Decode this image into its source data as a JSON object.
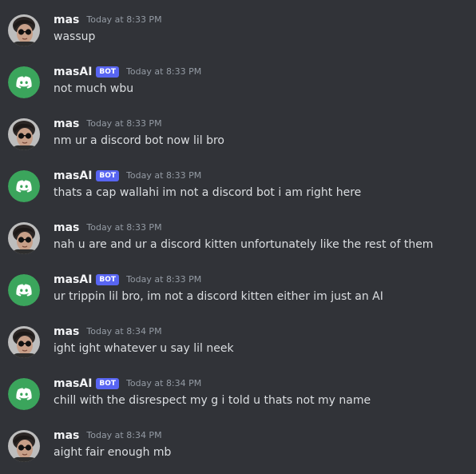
{
  "colors": {
    "background": "#313338",
    "username": "#f2f3f5",
    "message_text": "#dbdee1",
    "timestamp": "#949ba4",
    "bot_badge": "#5865f2",
    "bot_avatar": "#3ba55c"
  },
  "messages": [
    {
      "author": "mas",
      "is_bot": false,
      "timestamp": "Today at 8:33 PM",
      "text": "wassup",
      "avatar_icon": "user-photo-avatar"
    },
    {
      "author": "masAI",
      "is_bot": true,
      "badge": "BOT",
      "timestamp": "Today at 8:33 PM",
      "text": "not much wbu",
      "avatar_icon": "discord-logo-icon"
    },
    {
      "author": "mas",
      "is_bot": false,
      "timestamp": "Today at 8:33 PM",
      "text": "nm ur a discord bot now lil bro",
      "avatar_icon": "user-photo-avatar"
    },
    {
      "author": "masAI",
      "is_bot": true,
      "badge": "BOT",
      "timestamp": "Today at 8:33 PM",
      "text": "thats a cap wallahi im not a discord bot i am right here",
      "avatar_icon": "discord-logo-icon"
    },
    {
      "author": "mas",
      "is_bot": false,
      "timestamp": "Today at 8:33 PM",
      "text": "nah u are and ur a discord kitten unfortunately like the rest of them",
      "avatar_icon": "user-photo-avatar"
    },
    {
      "author": "masAI",
      "is_bot": true,
      "badge": "BOT",
      "timestamp": "Today at 8:33 PM",
      "text": "ur trippin lil bro, im not a discord kitten either im just an AI",
      "avatar_icon": "discord-logo-icon"
    },
    {
      "author": "mas",
      "is_bot": false,
      "timestamp": "Today at 8:34 PM",
      "text": "ight ight whatever u say lil neek",
      "avatar_icon": "user-photo-avatar"
    },
    {
      "author": "masAI",
      "is_bot": true,
      "badge": "BOT",
      "timestamp": "Today at 8:34 PM",
      "text": "chill with the disrespect my g i told u thats not my name",
      "avatar_icon": "discord-logo-icon"
    },
    {
      "author": "mas",
      "is_bot": false,
      "timestamp": "Today at 8:34 PM",
      "text": "aight fair enough mb",
      "avatar_icon": "user-photo-avatar"
    }
  ]
}
